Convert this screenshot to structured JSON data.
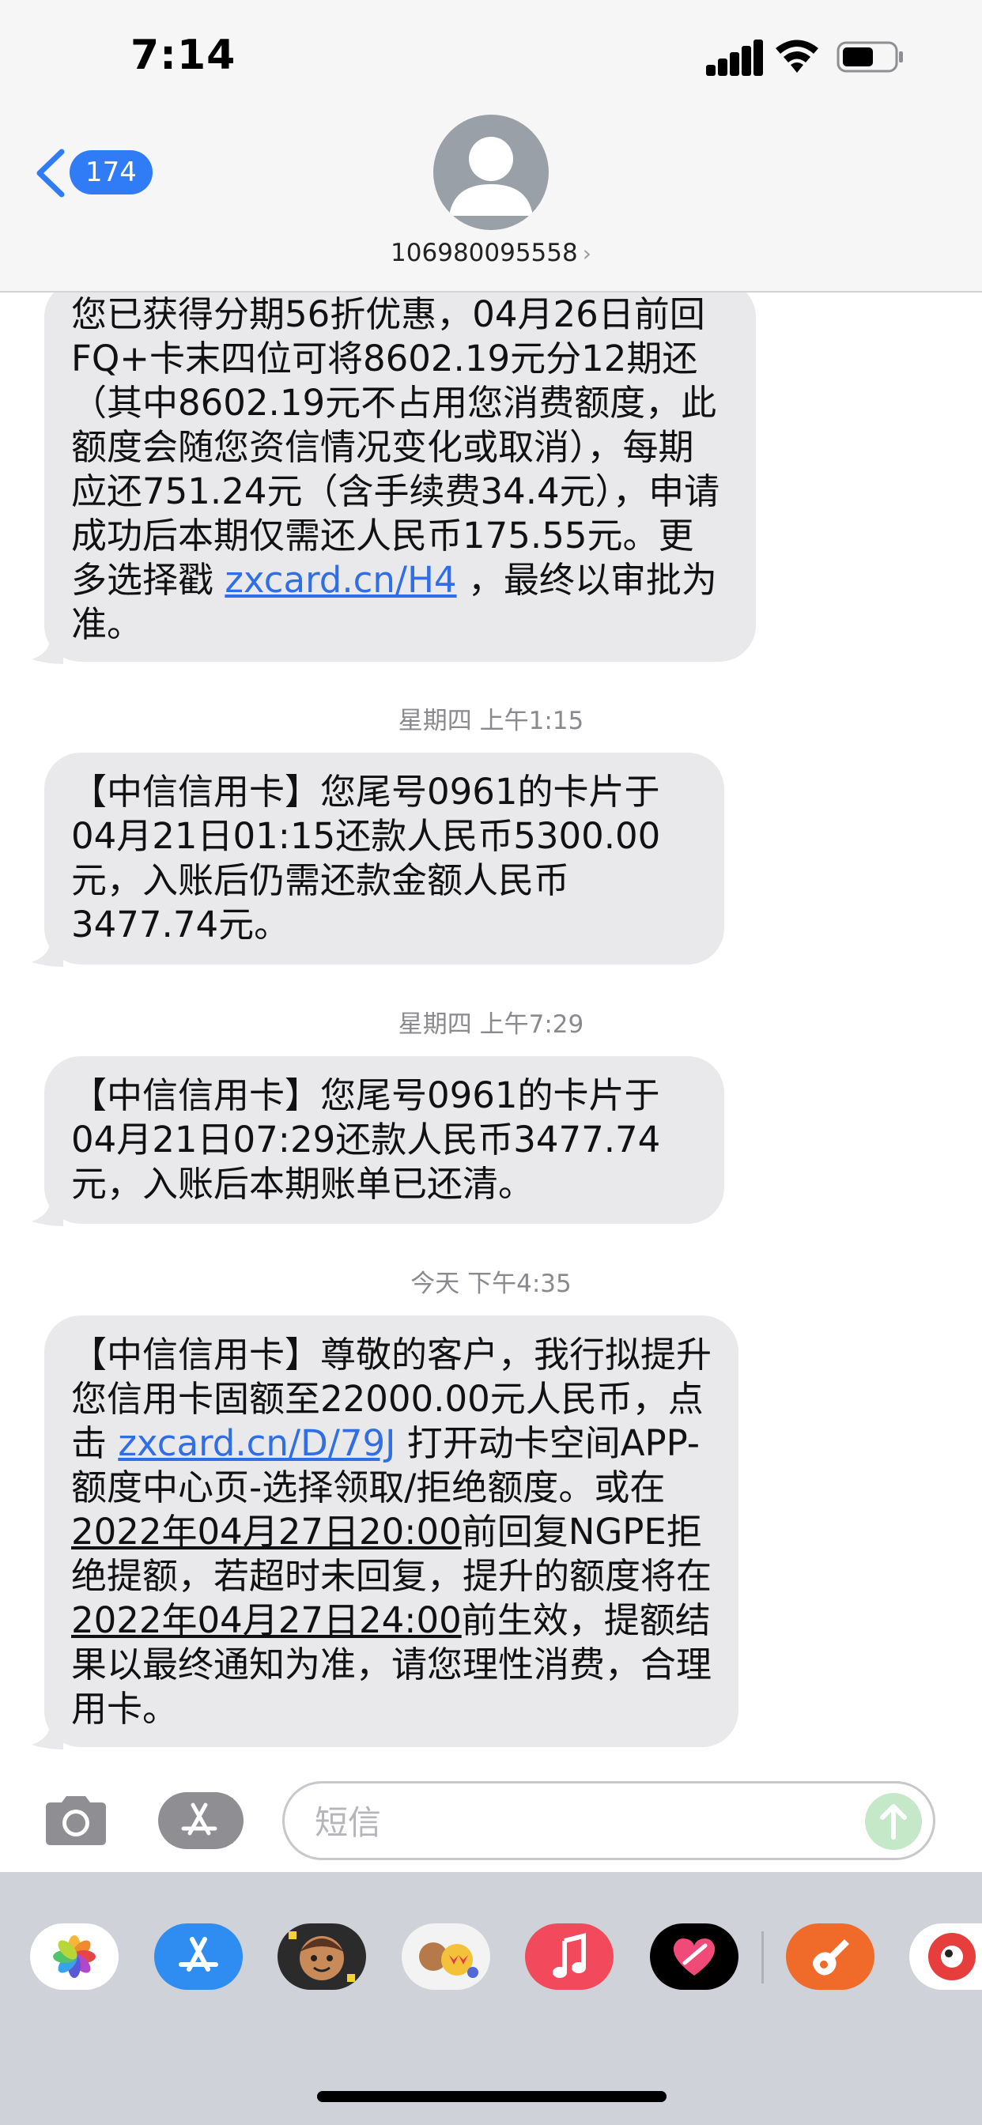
{
  "status_bar": {
    "time": "7:14"
  },
  "header": {
    "back_count": "174",
    "contact_number": "106980095558",
    "contact_chevron": "›"
  },
  "messages": [
    {
      "parts": [
        "您已获得分期56折优惠，04月26日前回FQ+卡末四位可将8602.19元分12期还（其中8602.19元不占用您消费额度，此额度会随您资信情况变化或取消），每期应还751.24元（含手续费34.4元），申请成功后本期仅需还人民币175.55元。更多选择戳 ",
        "zxcard.cn/H4",
        " ，最终以审批为准。"
      ]
    },
    {
      "timestamp": "星期四 上午1:15"
    },
    {
      "parts": [
        "【中信信用卡】您尾号0961的卡片于04月21日01:15还款人民币5300.00元，入账后仍需还款金额人民币3477.74元。"
      ]
    },
    {
      "timestamp": "星期四 上午7:29"
    },
    {
      "parts": [
        "【中信信用卡】您尾号0961的卡片于04月21日07:29还款人民币3477.74元，入账后本期账单已还清。"
      ]
    },
    {
      "timestamp": "今天 下午4:35"
    },
    {
      "parts": [
        "【中信信用卡】尊敬的客户，我行拟提升您信用卡固额至22000.00元人民币，点击 ",
        "zxcard.cn/D/79J",
        " 打开动卡空间APP-额度中心页-选择领取/拒绝额度。或在",
        "2022年04月27日20:00",
        "前回复NGPE拒绝提额，若超时未回复，提升的额度将在",
        "2022年04月27日24:00",
        "前生效，提额结果以最终通知为准，请您理性消费，合理用卡。"
      ]
    }
  ],
  "compose": {
    "placeholder": "短信"
  },
  "icons": {
    "status": [
      "cellular-signal-icon",
      "wifi-icon",
      "battery-icon"
    ],
    "compose": [
      "camera-icon",
      "app-store-icon",
      "send-arrow-icon"
    ],
    "drawer": [
      "photos-app-icon",
      "app-store-app-icon",
      "memoji-app-icon",
      "animoji-app-icon",
      "music-app-icon",
      "heart-app-icon",
      "garageband-app-icon",
      "partial-app-icon"
    ]
  },
  "colors": {
    "link": "#2f6ee5",
    "bubble": "#e9e9eb",
    "badge": "#2f7cf6",
    "send": "#c5e8c9"
  }
}
